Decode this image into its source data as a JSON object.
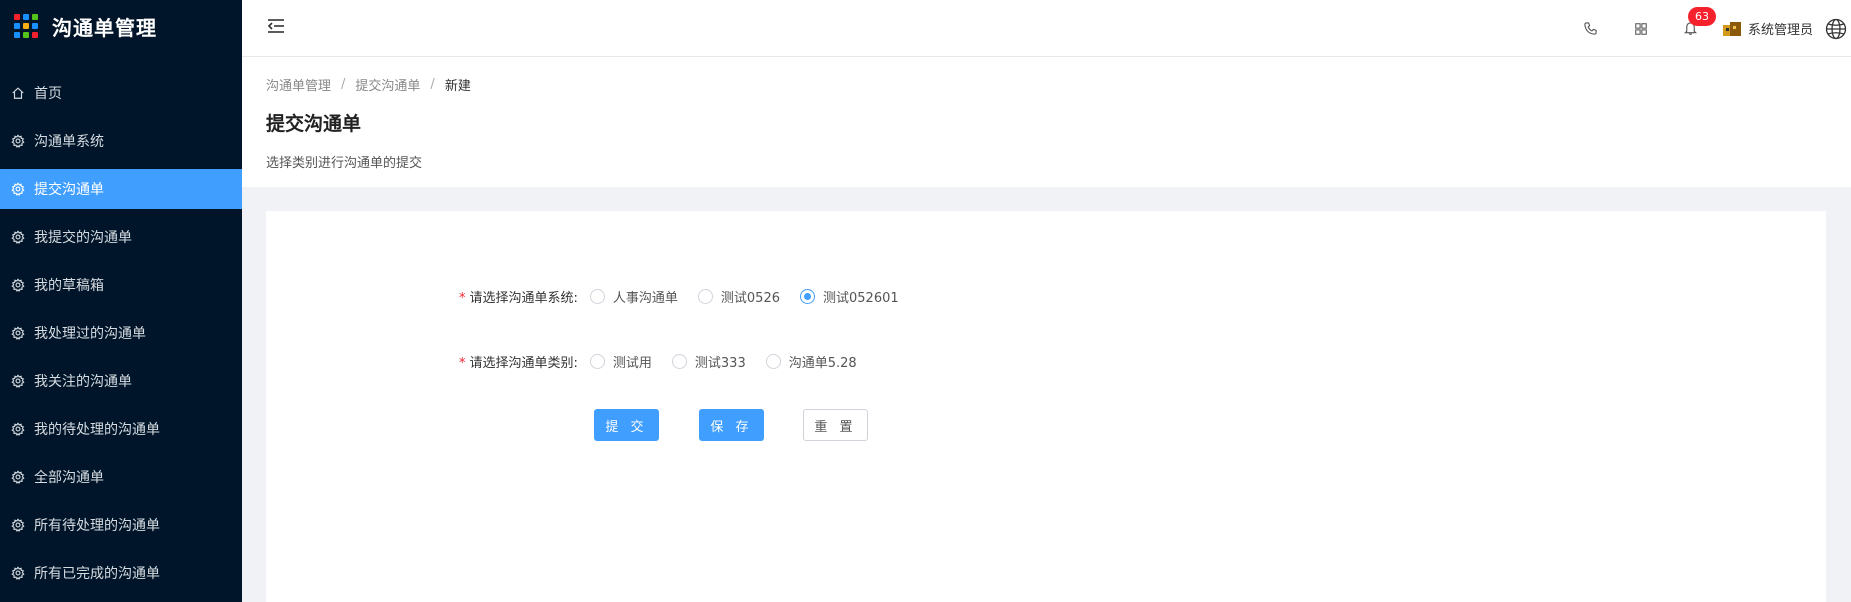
{
  "app": {
    "title": "沟通单管理",
    "logo_colors": [
      "#f5222d",
      "#1890ff",
      "#52c41a",
      "#1890ff",
      "#faad14",
      "#1890ff",
      "#1890ff",
      "#52c41a",
      "#f5222d"
    ]
  },
  "sidebar": {
    "items": [
      {
        "label": "首页",
        "icon": "home-icon",
        "active": false
      },
      {
        "label": "沟通单系统",
        "icon": "gear-icon",
        "active": false
      },
      {
        "label": "提交沟通单",
        "icon": "gear-icon",
        "active": true
      },
      {
        "label": "我提交的沟通单",
        "icon": "gear-icon",
        "active": false
      },
      {
        "label": "我的草稿箱",
        "icon": "gear-icon",
        "active": false
      },
      {
        "label": "我处理过的沟通单",
        "icon": "gear-icon",
        "active": false
      },
      {
        "label": "我关注的沟通单",
        "icon": "gear-icon",
        "active": false
      },
      {
        "label": "我的待处理的沟通单",
        "icon": "gear-icon",
        "active": false
      },
      {
        "label": "全部沟通单",
        "icon": "gear-icon",
        "active": false
      },
      {
        "label": "所有待处理的沟通单",
        "icon": "gear-icon",
        "active": false
      },
      {
        "label": "所有已完成的沟通单",
        "icon": "gear-icon",
        "active": false
      }
    ]
  },
  "header": {
    "notification_count": "63",
    "user_name": "系统管理员"
  },
  "breadcrumb": {
    "items": [
      "沟通单管理",
      "提交沟通单",
      "新建"
    ],
    "separator": "/"
  },
  "page": {
    "title": "提交沟通单",
    "description": "选择类别进行沟通单的提交"
  },
  "form": {
    "system": {
      "required_mark": "*",
      "label": "请选择沟通单系统:",
      "options": [
        "人事沟通单",
        "测试0526",
        "测试052601"
      ],
      "selected": "测试052601"
    },
    "category": {
      "required_mark": "*",
      "label": "请选择沟通单类别:",
      "options": [
        "测试用",
        "测试333",
        "沟通单5.28"
      ],
      "selected": ""
    },
    "buttons": {
      "submit": "提 交",
      "save": "保 存",
      "reset": "重 置"
    }
  },
  "colors": {
    "sidebar_bg": "#001529",
    "accent": "#409eff",
    "badge": "#f5222d"
  }
}
